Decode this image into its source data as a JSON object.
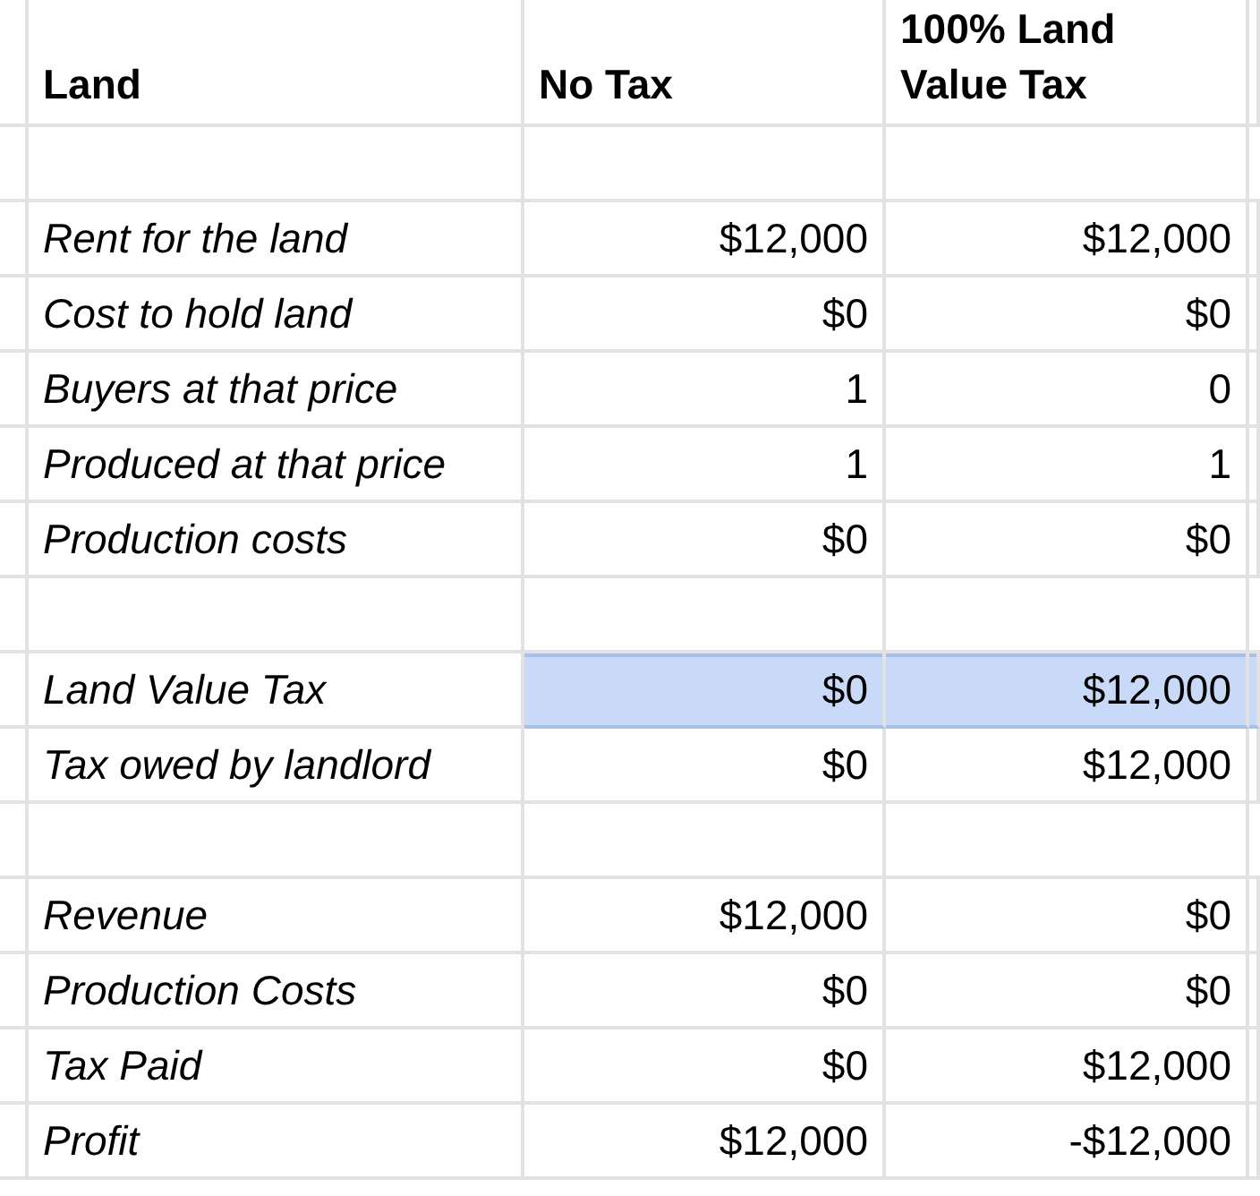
{
  "table": {
    "columns": [
      "Land",
      "No Tax",
      "100% Land Value Tax"
    ],
    "rows": [
      {
        "kind": "blank"
      },
      {
        "kind": "data",
        "label": "Rent for the land",
        "values": [
          "$12,000",
          "$12,000"
        ],
        "selected": false
      },
      {
        "kind": "data",
        "label": "Cost to hold land",
        "values": [
          "$0",
          "$0"
        ],
        "selected": false
      },
      {
        "kind": "data",
        "label": "Buyers at that price",
        "values": [
          "1",
          "0"
        ],
        "selected": false
      },
      {
        "kind": "data",
        "label": "Produced at that price",
        "values": [
          "1",
          "1"
        ],
        "selected": false
      },
      {
        "kind": "data",
        "label": "Production costs",
        "values": [
          "$0",
          "$0"
        ],
        "selected": false
      },
      {
        "kind": "blank"
      },
      {
        "kind": "data",
        "label": "Land Value Tax",
        "values": [
          "$0",
          "$12,000"
        ],
        "selected": true
      },
      {
        "kind": "data",
        "label": "Tax owed by landlord",
        "values": [
          "$0",
          "$12,000"
        ],
        "selected": false
      },
      {
        "kind": "blank"
      },
      {
        "kind": "data",
        "label": "Revenue",
        "values": [
          "$12,000",
          "$0"
        ],
        "selected": false
      },
      {
        "kind": "data",
        "label": "Production Costs",
        "values": [
          "$0",
          "$0"
        ],
        "selected": false
      },
      {
        "kind": "data",
        "label": "Tax Paid",
        "values": [
          "$0",
          "$12,000"
        ],
        "selected": false
      },
      {
        "kind": "data",
        "label": "Profit",
        "values": [
          "$12,000",
          "-$12,000"
        ],
        "selected": false
      }
    ]
  }
}
